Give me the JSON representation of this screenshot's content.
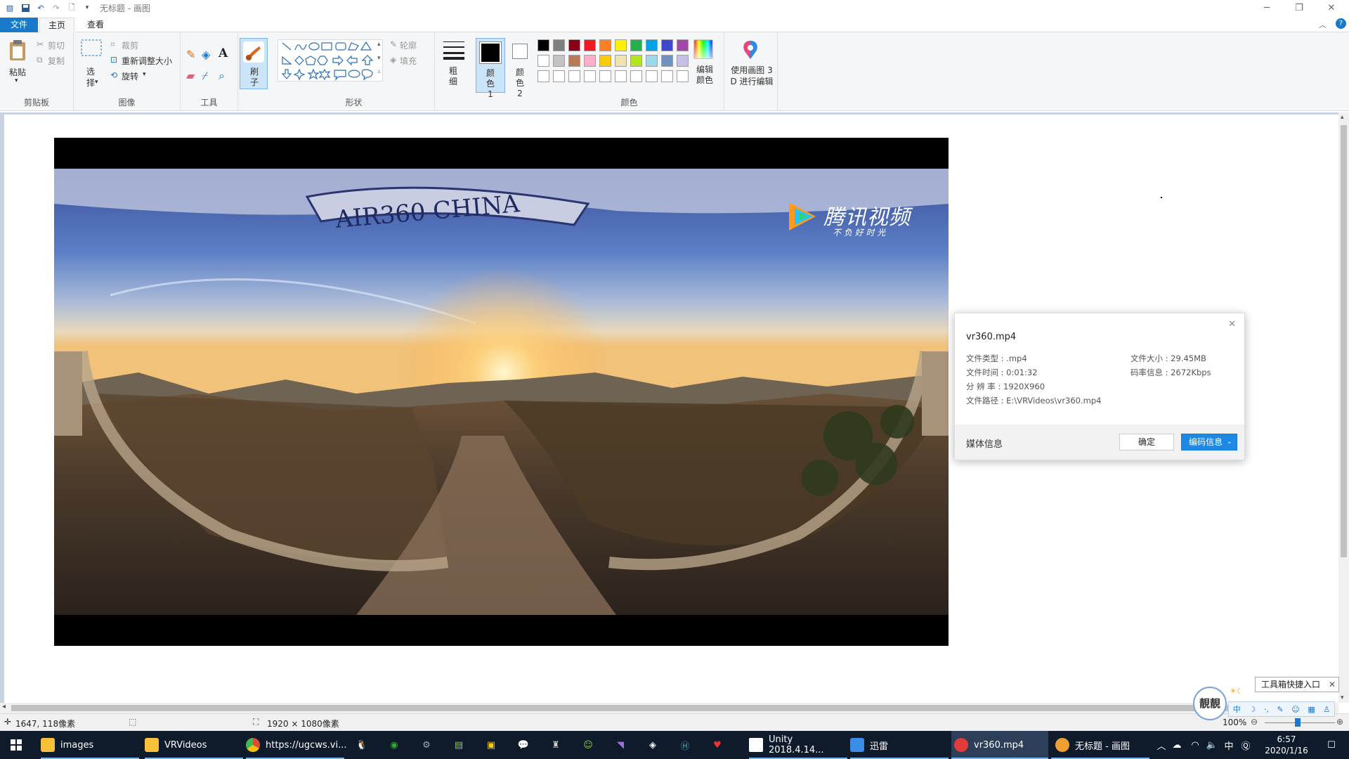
{
  "window": {
    "title": "无标题 - 画图",
    "min": "─",
    "max": "❐",
    "close": "✕"
  },
  "tabs": {
    "file": "文件",
    "home": "主页",
    "view": "查看"
  },
  "ribbon": {
    "clipboard": {
      "paste": "粘贴",
      "cut": "剪切",
      "copy": "复制",
      "group": "剪贴板"
    },
    "image": {
      "select": "选择",
      "crop": "裁剪",
      "resize": "重新调整大小",
      "rotate": "旋转",
      "group": "图像"
    },
    "tools": {
      "group": "工具"
    },
    "brushes": {
      "label": "刷子"
    },
    "shapes": {
      "outline": "轮廓",
      "fill": "填充",
      "group": "形状"
    },
    "size": {
      "label": "粗细"
    },
    "color1": {
      "label": "颜色 1"
    },
    "color2": {
      "label": "颜色 2"
    },
    "colors": {
      "group": "颜色",
      "edit": "编辑颜色"
    },
    "paint3d": {
      "label": "使用画图 3 D 进行编辑"
    },
    "palette": [
      "#000000",
      "#7f7f7f",
      "#880015",
      "#ed1c24",
      "#ff7f27",
      "#fff200",
      "#22b14c",
      "#00a2e8",
      "#3f48cc",
      "#a349a4",
      "#ffffff",
      "#c3c3c3",
      "#b97a57",
      "#ffaec9",
      "#ffc90e",
      "#efe4b0",
      "#b5e61d",
      "#99d9ea",
      "#7092be",
      "#c8bfe7"
    ]
  },
  "video": {
    "watermark_title": "腾讯视频",
    "watermark_sub": "不 负 好 时 光",
    "banner_text": "AIR360 CHINA"
  },
  "dialog": {
    "filename": "vr360.mp4",
    "type": "文件类型 : .mp4",
    "size": "文件大小 : 29.45MB",
    "duration": "文件时间 : 0:01:32",
    "bitrate": "码率信息 : 2672Kbps",
    "resolution": "分 辨 率 : 1920X960",
    "path": "文件路径 : E:\\VRVideos\\vr360.mp4",
    "media_info": "媒体信息",
    "ok": "确定",
    "codec": "编码信息"
  },
  "status": {
    "cursor": "1647, 118像素",
    "size": "1920 × 1080像素",
    "zoom": "100%"
  },
  "toolbox_popup": {
    "label": "工具箱快捷入口",
    "avatar": "靚靚"
  },
  "taskbar": {
    "items": [
      {
        "label": "images",
        "color": "#f8c13a"
      },
      {
        "label": "VRVideos",
        "color": "#f8c13a"
      },
      {
        "label": "https://ugcws.vi...",
        "color": "#dd4b39"
      },
      {
        "label": "Unity 2018.4.14...",
        "color": "#ffffff"
      },
      {
        "label": "迅雷",
        "color": "#3a8ee6"
      },
      {
        "label": "vr360.mp4",
        "color": "#e23b3b"
      },
      {
        "label": "无标题 - 画图",
        "color": "#f0a030"
      }
    ],
    "time": "6:57",
    "date": "2020/1/16",
    "ime": "中"
  }
}
